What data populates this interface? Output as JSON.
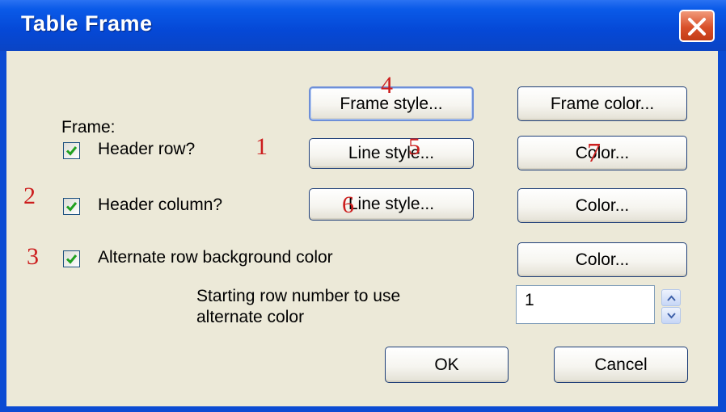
{
  "dialog": {
    "title": "Table Frame",
    "close_icon": "close-icon"
  },
  "frame": {
    "label": "Frame:",
    "style_button": "Frame style...",
    "color_button": "Frame color..."
  },
  "header_row": {
    "label": "Header row?",
    "checked": true,
    "line_style_button": "Line style...",
    "color_button": "Color..."
  },
  "header_column": {
    "label": "Header column?",
    "checked": true,
    "line_style_button": "Line style...",
    "color_button": "Color..."
  },
  "alternate_row": {
    "label": "Alternate row background color",
    "checked": true,
    "color_button": "Color..."
  },
  "starting_row": {
    "label_line1": "Starting row number to use",
    "label_line2": "alternate color",
    "value": "1"
  },
  "actions": {
    "ok": "OK",
    "cancel": "Cancel"
  },
  "annotations": {
    "a1": "1",
    "a2": "2",
    "a3": "3",
    "a4": "4",
    "a5": "5",
    "a6": "6",
    "a7": "7"
  },
  "colors": {
    "title_bar": "#0548d6",
    "dialog_bg": "#ece9d8",
    "check_mark": "#21a121",
    "annotation": "#cc1d1d"
  }
}
